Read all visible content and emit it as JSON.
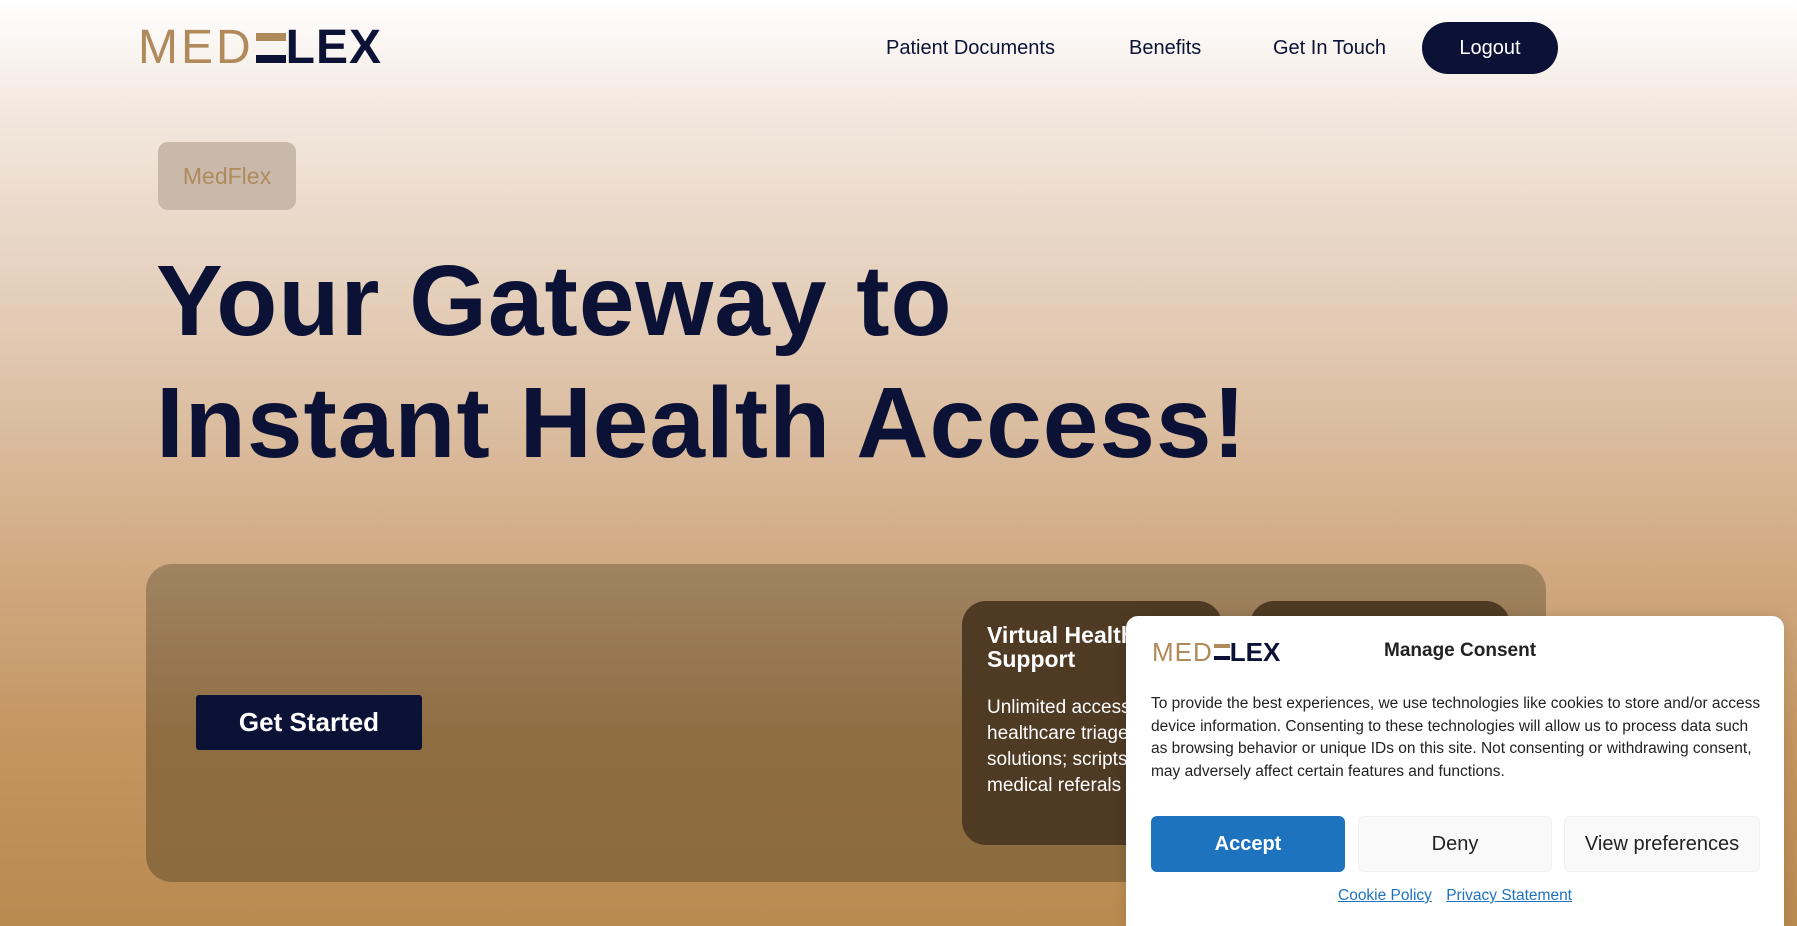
{
  "header": {
    "logo": {
      "part1": "MED",
      "part2": "LEX",
      "full": "MEDFLEX"
    },
    "nav": [
      {
        "label": "Patient Documents"
      },
      {
        "label": "Benefits"
      },
      {
        "label": "Get In Touch"
      }
    ],
    "logout_label": "Logout"
  },
  "hero": {
    "badge": "MedFlex",
    "title_line1": "Your Gateway to",
    "title_line2": "Instant Health Access!",
    "cta_label": "Get Started",
    "feature_card": {
      "title": "Virtual Health Support",
      "text": "Unlimited access to healthcare triage solutions; scripts, medical referals"
    }
  },
  "consent": {
    "logo": {
      "part1": "MED",
      "part2": "LEX"
    },
    "title": "Manage Consent",
    "body": "To provide the best experiences, we use technologies like cookies to store and/or access device information. Consenting to these technologies will allow us to process data such as browsing behavior or unique IDs on this site. Not consenting or withdrawing consent, may adversely affect certain features and functions.",
    "accept_label": "Accept",
    "deny_label": "Deny",
    "prefs_label": "View preferences",
    "links": [
      {
        "label": "Cookie Policy"
      },
      {
        "label": "Privacy Statement"
      }
    ]
  },
  "colors": {
    "navy": "#0b1236",
    "gold": "#b18a5c",
    "accept_blue": "#1e73be"
  }
}
